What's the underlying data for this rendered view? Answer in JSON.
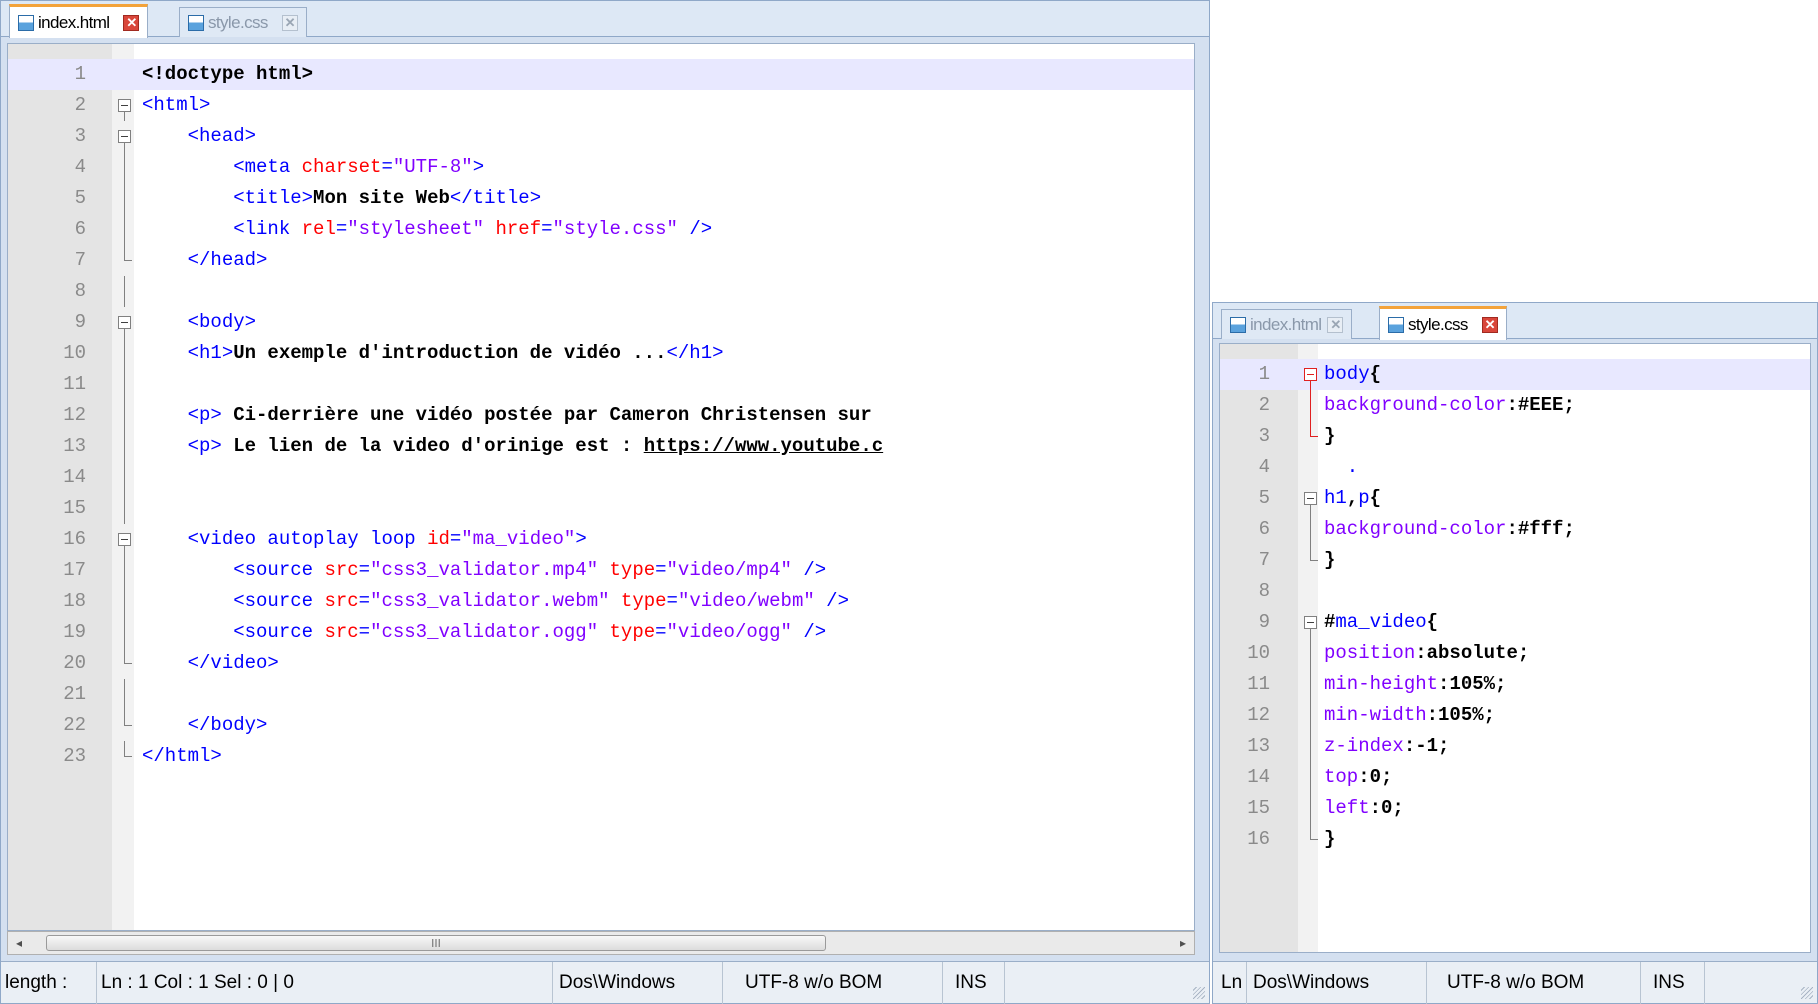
{
  "left": {
    "tabs": [
      {
        "label": "index.html",
        "active": true
      },
      {
        "label": "style.css",
        "active": false
      }
    ],
    "close_glyph": "✕",
    "scroll": {
      "left": "◂",
      "right": "▸",
      "thumb_grip": "III"
    },
    "lines": [
      {
        "n": "1",
        "tokens": [
          {
            "t": "<!doctype html>",
            "c": "txt"
          }
        ]
      },
      {
        "n": "2",
        "tokens": [
          {
            "t": "<html>",
            "c": "tag"
          }
        ]
      },
      {
        "n": "3",
        "tokens": [
          {
            "t": "    ",
            "c": "txt"
          },
          {
            "t": "<head>",
            "c": "tag"
          }
        ]
      },
      {
        "n": "4",
        "tokens": [
          {
            "t": "        ",
            "c": "txt"
          },
          {
            "t": "<meta ",
            "c": "tag"
          },
          {
            "t": "charset",
            "c": "attr"
          },
          {
            "t": "=",
            "c": "tag"
          },
          {
            "t": "\"UTF-8\"",
            "c": "str"
          },
          {
            "t": ">",
            "c": "tag"
          }
        ]
      },
      {
        "n": "5",
        "tokens": [
          {
            "t": "        ",
            "c": "txt"
          },
          {
            "t": "<title>",
            "c": "tag"
          },
          {
            "t": "Mon site Web",
            "c": "txt"
          },
          {
            "t": "</title>",
            "c": "tag"
          }
        ]
      },
      {
        "n": "6",
        "tokens": [
          {
            "t": "        ",
            "c": "txt"
          },
          {
            "t": "<link ",
            "c": "tag"
          },
          {
            "t": "rel",
            "c": "attr"
          },
          {
            "t": "=",
            "c": "tag"
          },
          {
            "t": "\"stylesheet\"",
            "c": "str"
          },
          {
            "t": " ",
            "c": "tag"
          },
          {
            "t": "href",
            "c": "attr"
          },
          {
            "t": "=",
            "c": "tag"
          },
          {
            "t": "\"style.css\"",
            "c": "str"
          },
          {
            "t": " />",
            "c": "tag"
          }
        ]
      },
      {
        "n": "7",
        "tokens": [
          {
            "t": "    ",
            "c": "txt"
          },
          {
            "t": "</head>",
            "c": "tag"
          }
        ]
      },
      {
        "n": "8",
        "tokens": []
      },
      {
        "n": "9",
        "tokens": [
          {
            "t": "    ",
            "c": "txt"
          },
          {
            "t": "<body>",
            "c": "tag"
          }
        ]
      },
      {
        "n": "10",
        "tokens": [
          {
            "t": "    ",
            "c": "txt"
          },
          {
            "t": "<h1>",
            "c": "tag"
          },
          {
            "t": "Un exemple d'introduction de vidéo ...",
            "c": "txt"
          },
          {
            "t": "</h1>",
            "c": "tag"
          }
        ]
      },
      {
        "n": "11",
        "tokens": []
      },
      {
        "n": "12",
        "tokens": [
          {
            "t": "    ",
            "c": "txt"
          },
          {
            "t": "<p>",
            "c": "tag"
          },
          {
            "t": " Ci-derrière une vidéo postée par Cameron Christensen sur",
            "c": "txt"
          }
        ]
      },
      {
        "n": "13",
        "tokens": [
          {
            "t": "    ",
            "c": "txt"
          },
          {
            "t": "<p>",
            "c": "tag"
          },
          {
            "t": " Le lien de la video d'orinige est : ",
            "c": "txt"
          },
          {
            "t": "https://www.youtube.c",
            "c": "link"
          }
        ]
      },
      {
        "n": "14",
        "tokens": []
      },
      {
        "n": "15",
        "tokens": []
      },
      {
        "n": "16",
        "tokens": [
          {
            "t": "    ",
            "c": "txt"
          },
          {
            "t": "<video autoplay loop ",
            "c": "tag"
          },
          {
            "t": "id",
            "c": "attr"
          },
          {
            "t": "=",
            "c": "tag"
          },
          {
            "t": "\"ma_video\"",
            "c": "str"
          },
          {
            "t": ">",
            "c": "tag"
          }
        ]
      },
      {
        "n": "17",
        "tokens": [
          {
            "t": "        ",
            "c": "txt"
          },
          {
            "t": "<source ",
            "c": "tag"
          },
          {
            "t": "src",
            "c": "attr"
          },
          {
            "t": "=",
            "c": "tag"
          },
          {
            "t": "\"css3_validator.mp4\"",
            "c": "str"
          },
          {
            "t": " ",
            "c": "tag"
          },
          {
            "t": "type",
            "c": "attr"
          },
          {
            "t": "=",
            "c": "tag"
          },
          {
            "t": "\"video/mp4\"",
            "c": "str"
          },
          {
            "t": " />",
            "c": "tag"
          }
        ]
      },
      {
        "n": "18",
        "tokens": [
          {
            "t": "        ",
            "c": "txt"
          },
          {
            "t": "<source ",
            "c": "tag"
          },
          {
            "t": "src",
            "c": "attr"
          },
          {
            "t": "=",
            "c": "tag"
          },
          {
            "t": "\"css3_validator.webm\"",
            "c": "str"
          },
          {
            "t": " ",
            "c": "tag"
          },
          {
            "t": "type",
            "c": "attr"
          },
          {
            "t": "=",
            "c": "tag"
          },
          {
            "t": "\"video/webm\"",
            "c": "str"
          },
          {
            "t": " />",
            "c": "tag"
          }
        ]
      },
      {
        "n": "19",
        "tokens": [
          {
            "t": "        ",
            "c": "txt"
          },
          {
            "t": "<source ",
            "c": "tag"
          },
          {
            "t": "src",
            "c": "attr"
          },
          {
            "t": "=",
            "c": "tag"
          },
          {
            "t": "\"css3_validator.ogg\"",
            "c": "str"
          },
          {
            "t": " ",
            "c": "tag"
          },
          {
            "t": "type",
            "c": "attr"
          },
          {
            "t": "=",
            "c": "tag"
          },
          {
            "t": "\"video/ogg\"",
            "c": "str"
          },
          {
            "t": " />",
            "c": "tag"
          }
        ]
      },
      {
        "n": "20",
        "tokens": [
          {
            "t": "    ",
            "c": "txt"
          },
          {
            "t": "</video>",
            "c": "tag"
          }
        ]
      },
      {
        "n": "21",
        "tokens": []
      },
      {
        "n": "22",
        "tokens": [
          {
            "t": "    ",
            "c": "txt"
          },
          {
            "t": "</body>",
            "c": "tag"
          }
        ]
      },
      {
        "n": "23",
        "tokens": [
          {
            "t": "</html>",
            "c": "tag"
          }
        ]
      }
    ],
    "status": {
      "length": "length :",
      "pos": "Ln : 1    Col : 1    Sel : 0 | 0",
      "eol": "Dos\\Windows",
      "encoding": "UTF-8 w/o BOM",
      "mode": "INS"
    }
  },
  "right": {
    "tabs": [
      {
        "label": "index.html",
        "active": false
      },
      {
        "label": "style.css",
        "active": true
      }
    ],
    "close_glyph": "✕",
    "lines": [
      {
        "n": "1",
        "tokens": [
          {
            "t": "body",
            "c": "sel"
          },
          {
            "t": "{",
            "c": "punc"
          }
        ]
      },
      {
        "n": "2",
        "tokens": [
          {
            "t": "background-color",
            "c": "prop"
          },
          {
            "t": ":",
            "c": "punc"
          },
          {
            "t": "#EEE",
            "c": "val"
          },
          {
            "t": ";",
            "c": "punc"
          }
        ]
      },
      {
        "n": "3",
        "tokens": [
          {
            "t": "}",
            "c": "punc"
          }
        ]
      },
      {
        "n": "4",
        "tokens": [
          {
            "t": "  .",
            "c": "sel"
          }
        ]
      },
      {
        "n": "5",
        "tokens": [
          {
            "t": "h1",
            "c": "sel"
          },
          {
            "t": ",",
            "c": "punc"
          },
          {
            "t": "p",
            "c": "sel"
          },
          {
            "t": "{",
            "c": "punc"
          }
        ]
      },
      {
        "n": "6",
        "tokens": [
          {
            "t": "background-color",
            "c": "prop"
          },
          {
            "t": ":",
            "c": "punc"
          },
          {
            "t": "#fff",
            "c": "val"
          },
          {
            "t": ";",
            "c": "punc"
          }
        ]
      },
      {
        "n": "7",
        "tokens": [
          {
            "t": "}",
            "c": "punc"
          }
        ]
      },
      {
        "n": "8",
        "tokens": []
      },
      {
        "n": "9",
        "tokens": [
          {
            "t": "#",
            "c": "punc"
          },
          {
            "t": "ma_video",
            "c": "sel"
          },
          {
            "t": "{",
            "c": "punc"
          }
        ]
      },
      {
        "n": "10",
        "tokens": [
          {
            "t": "position",
            "c": "prop"
          },
          {
            "t": ":",
            "c": "punc"
          },
          {
            "t": "absolute",
            "c": "val"
          },
          {
            "t": ";",
            "c": "punc"
          }
        ]
      },
      {
        "n": "11",
        "tokens": [
          {
            "t": "min-height",
            "c": "prop"
          },
          {
            "t": ":",
            "c": "punc"
          },
          {
            "t": "105%",
            "c": "val"
          },
          {
            "t": ";",
            "c": "punc"
          }
        ]
      },
      {
        "n": "12",
        "tokens": [
          {
            "t": "min-width",
            "c": "prop"
          },
          {
            "t": ":",
            "c": "punc"
          },
          {
            "t": "105%",
            "c": "val"
          },
          {
            "t": ";",
            "c": "punc"
          }
        ]
      },
      {
        "n": "13",
        "tokens": [
          {
            "t": "z-index",
            "c": "prop"
          },
          {
            "t": ":",
            "c": "punc"
          },
          {
            "t": "-1",
            "c": "val"
          },
          {
            "t": ";",
            "c": "punc"
          }
        ]
      },
      {
        "n": "14",
        "tokens": [
          {
            "t": "top",
            "c": "prop"
          },
          {
            "t": ":",
            "c": "punc"
          },
          {
            "t": "0",
            "c": "val"
          },
          {
            "t": ";",
            "c": "punc"
          }
        ]
      },
      {
        "n": "15",
        "tokens": [
          {
            "t": "left",
            "c": "prop"
          },
          {
            "t": ":",
            "c": "punc"
          },
          {
            "t": "0",
            "c": "val"
          },
          {
            "t": ";",
            "c": "punc"
          }
        ]
      },
      {
        "n": "16",
        "tokens": [
          {
            "t": "}",
            "c": "punc"
          }
        ]
      }
    ],
    "status": {
      "pos": "Ln",
      "eol": "Dos\\Windows",
      "encoding": "UTF-8 w/o BOM",
      "mode": "INS"
    }
  },
  "colors": {
    "tab_accent": "#f3a33a",
    "close_active": "#d9463a",
    "current_line": "#e8e8ff",
    "fold_active": "#e02020"
  }
}
